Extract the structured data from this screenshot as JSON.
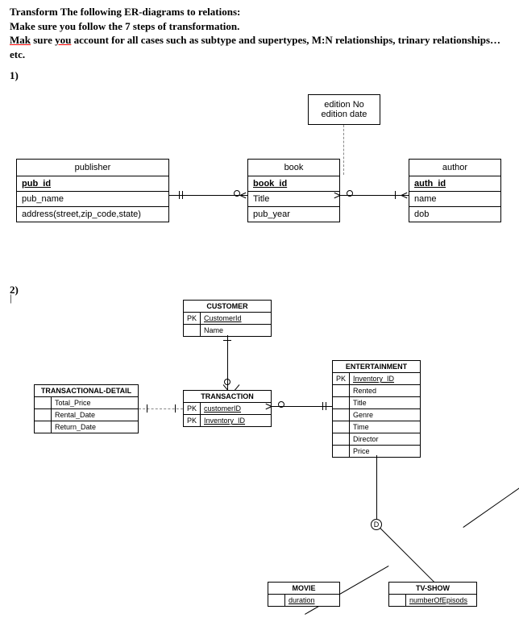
{
  "instructions": {
    "line1a": "Transform The following ER-diagrams  to relations:",
    "line2": "Make sure you follow the 7 steps of transformation.",
    "line3a": "Mak",
    "line3b": " sure ",
    "line3c": "you",
    "line3d": " account for all cases such as subtype and supertypes, M:N relationships, trinary relationships…etc."
  },
  "q1_label": "1)",
  "q2_label": "2)",
  "d1": {
    "weak": {
      "l1": "edition No",
      "l2": "edition date"
    },
    "publisher": {
      "title": "publisher",
      "pk": "pub_id",
      "a1": "pub_name",
      "a2": "address(street,zip_code,state)"
    },
    "book": {
      "title": "book",
      "pk": "book_id",
      "a1": "Title",
      "a2": "pub_year"
    },
    "author": {
      "title": "author",
      "pk": "auth_id",
      "a1": "name",
      "a2": "dob"
    }
  },
  "d2": {
    "customer": {
      "title": "CUSTOMER",
      "pk_label": "PK",
      "pk": "CustomerId",
      "a1": "Name"
    },
    "tdetail": {
      "title": "TRANSACTIONAL-DETAIL",
      "a1": "Total_Price",
      "a2": "Rental_Date",
      "a3": "Return_Date"
    },
    "transaction": {
      "title": "TRANSACTION",
      "pk_label": "PK",
      "pk1": "customerID",
      "pk2": "Inventory_ID"
    },
    "entertainment": {
      "title": "ENTERTAINMENT",
      "pk_label": "PK",
      "pk": "Inventory_ID",
      "a1": "Rented",
      "a2": "Title",
      "a3": "Genre",
      "a4": "Time",
      "a5": "Director",
      "a6": "Price"
    },
    "movie": {
      "title": "MOVIE",
      "a1": "duration"
    },
    "tvshow": {
      "title": "TV-SHOW",
      "a1": "numberOfEpisods"
    },
    "disc": "D"
  }
}
